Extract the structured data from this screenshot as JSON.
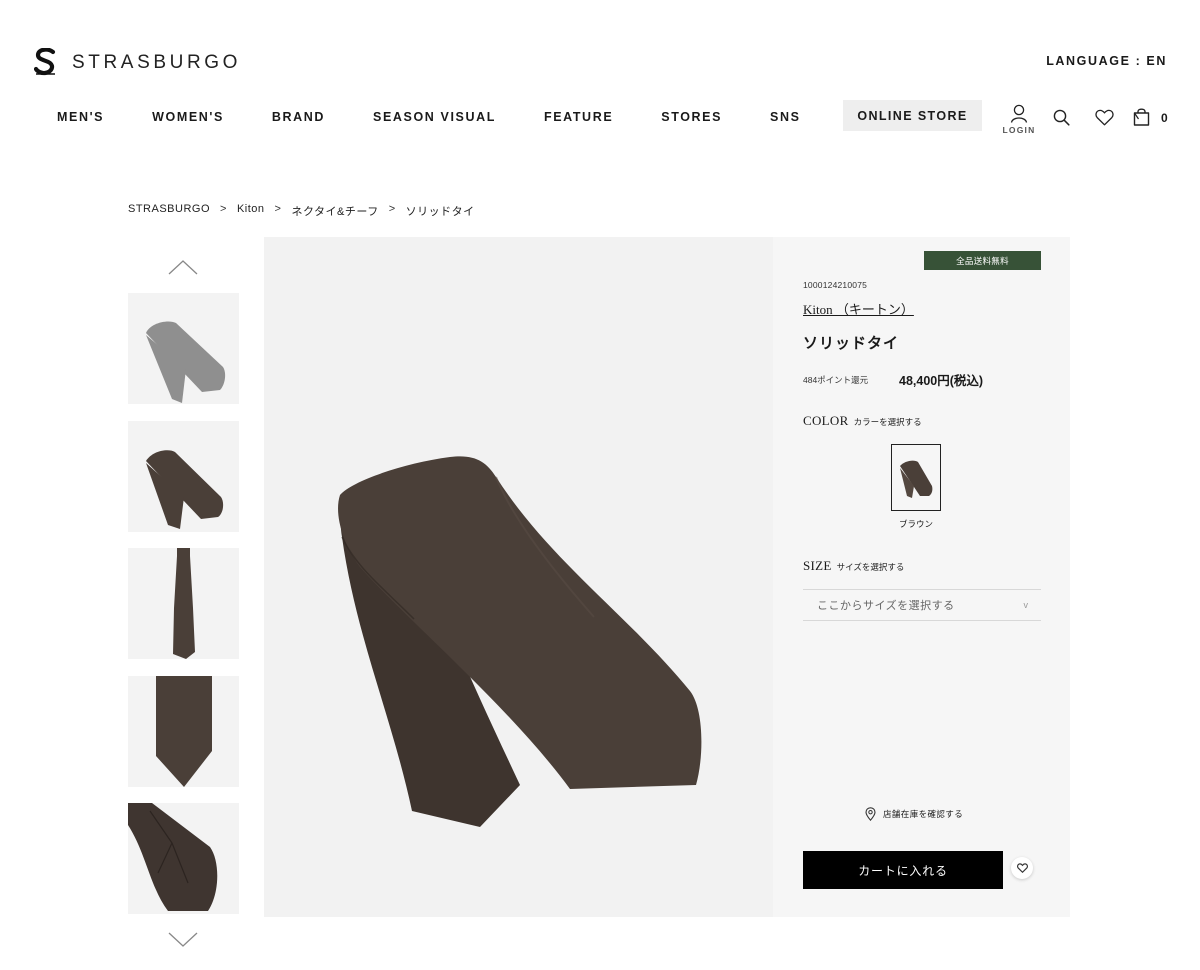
{
  "header": {
    "logo_text": "STRASBURGO",
    "language_label": "LANGUAGE : EN",
    "online_store_label": "ONLINE STORE",
    "login_label": "LOGIN",
    "cart_count": "0"
  },
  "nav": {
    "items": [
      {
        "label": "MEN'S"
      },
      {
        "label": "WOMEN'S"
      },
      {
        "label": "BRAND"
      },
      {
        "label": "SEASON VISUAL"
      },
      {
        "label": "FEATURE"
      },
      {
        "label": "STORES"
      },
      {
        "label": "SNS"
      }
    ]
  },
  "breadcrumb": {
    "items": [
      "STRASBURGO",
      "Kiton",
      "ネクタイ&チーフ",
      "ソリッドタイ"
    ],
    "separator": ">"
  },
  "product": {
    "badge": "全品送料無料",
    "code": "1000124210075",
    "brand": "Kiton （キートン）",
    "name": "ソリッドタイ",
    "points": "484ポイント還元",
    "price": "48,400円(税込)",
    "color_title": "COLOR",
    "color_hint": "カラーを選択する",
    "color_options": [
      {
        "label": "ブラウン",
        "color": "#4a3f38"
      }
    ],
    "size_title": "SIZE",
    "size_hint": "サイズを選択する",
    "size_placeholder": "ここからサイズを選択する",
    "size_chevron": "v",
    "store_stock_label": "店舗在庫を確認する",
    "add_to_cart_label": "カートに入れる",
    "tie_color": "#4a3f38",
    "badge_color": "#375237"
  },
  "thumbnails": [
    {
      "name": "grey-tie",
      "color": "#8f8f8f"
    },
    {
      "name": "brown-tie-angled",
      "color": "#4a3f38"
    },
    {
      "name": "brown-tie-full",
      "color": "#4a3f38"
    },
    {
      "name": "brown-tie-blade",
      "color": "#4a3f38"
    },
    {
      "name": "brown-tie-back",
      "color": "#3f3530"
    }
  ]
}
